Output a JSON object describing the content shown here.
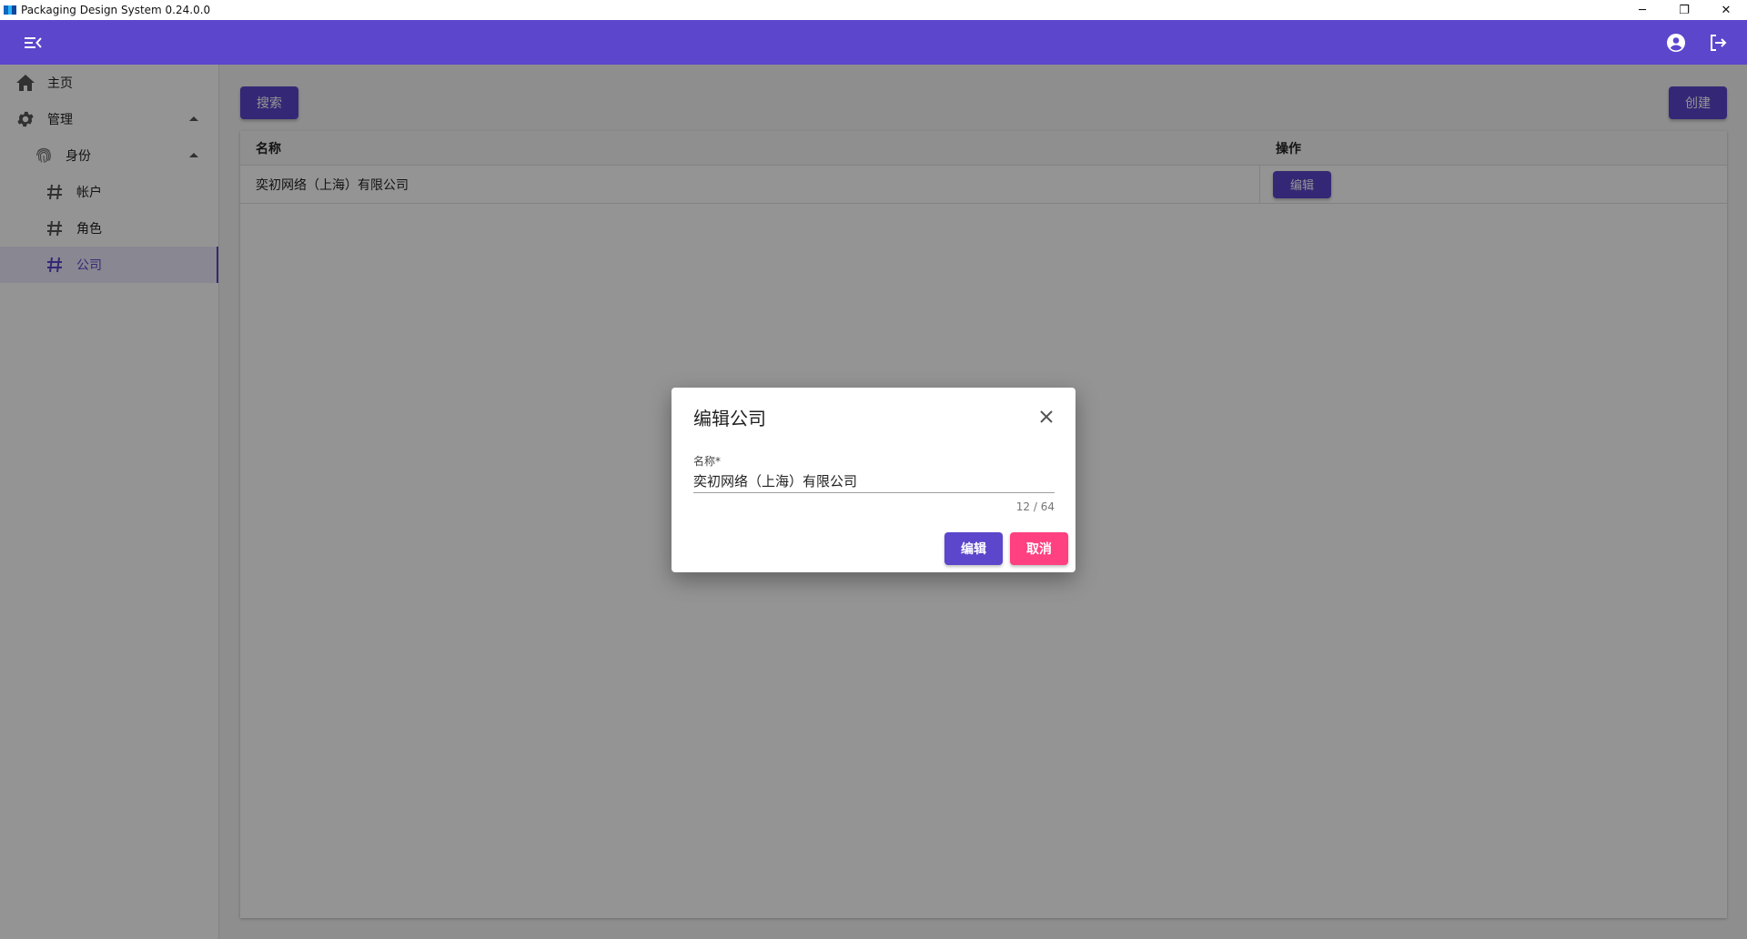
{
  "window": {
    "title": "Packaging Design System 0.24.0.0",
    "controls": {
      "minimize": "─",
      "restore": "❐",
      "close": "✕"
    }
  },
  "appbar": {
    "menu_icon": "menu-open-icon",
    "account_icon": "account-circle-icon",
    "logout_icon": "logout-icon",
    "color": "#5b46cc"
  },
  "sidebar": {
    "items": [
      {
        "label": "主页",
        "icon": "home-icon"
      },
      {
        "label": "管理",
        "icon": "gear-icon",
        "expanded": true
      },
      {
        "label": "身份",
        "icon": "fingerprint-icon",
        "expanded": true
      },
      {
        "label": "帐户",
        "icon": "hash-icon"
      },
      {
        "label": "角色",
        "icon": "hash-icon"
      },
      {
        "label": "公司",
        "icon": "hash-icon",
        "active": true
      }
    ]
  },
  "toolbar": {
    "search_label": "搜索",
    "create_label": "创建"
  },
  "table": {
    "columns": [
      "名称",
      "操作"
    ],
    "rows": [
      {
        "name": "奕初网络（上海）有限公司",
        "action_label": "编辑"
      }
    ]
  },
  "dialog": {
    "title": "编辑公司",
    "field_label": "名称*",
    "field_value": "奕初网络（上海）有限公司",
    "counter": "12 / 64",
    "confirm_label": "编辑",
    "cancel_label": "取消",
    "confirm_color": "#5b46cc",
    "cancel_color": "#ff4081"
  }
}
